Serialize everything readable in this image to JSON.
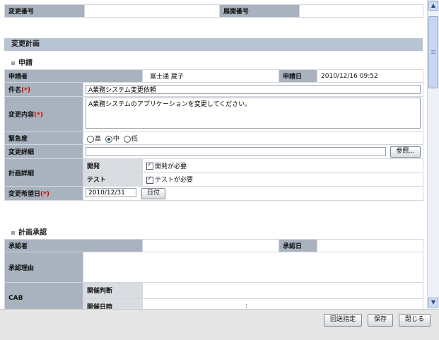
{
  "top_row": {
    "change_no_label": "変更番号",
    "change_no_value": "",
    "deploy_no_label": "展開番号",
    "deploy_no_value": ""
  },
  "plan_section": "変更計画",
  "application": {
    "heading": "申請",
    "applicant_label": "申請者",
    "applicant_value": "富士通 蔵子",
    "date_label": "申請日",
    "date_value": "2010/12/16 09:52",
    "subject_label": "件名",
    "subject_value": "A業務システム変更依頼",
    "content_label": "変更内容",
    "content_value": "A業務システムのアプリケーションを変更してください。",
    "required_mark": "(*)",
    "urgency_label": "緊急度",
    "urgency_options": [
      "高",
      "中",
      "低"
    ],
    "urgency_selected": "中",
    "detail_label": "変更詳細",
    "detail_value": "",
    "browse_button": "参照...",
    "plan_detail_label": "計画詳細",
    "dev_label": "開発",
    "dev_check": "開発が必要",
    "test_label": "テスト",
    "test_check": "テストが必要",
    "desired_date_label": "変更希望日",
    "desired_date_value": "2010/12/31",
    "date_button": "日付"
  },
  "approval": {
    "heading": "計画承認",
    "approver_label": "承認者",
    "approver_value": "",
    "approval_date_label": "承認日",
    "approval_date_value": "",
    "reason_label": "承認理由",
    "reason_value": "",
    "cab_label": "CAB",
    "held_decision_label": "開催判断",
    "held_datetime_label": "開催日時",
    "time_sep": ":"
  },
  "footer": {
    "return_button": "回送指定",
    "save_button": "保存",
    "close_button": "閉じる"
  }
}
